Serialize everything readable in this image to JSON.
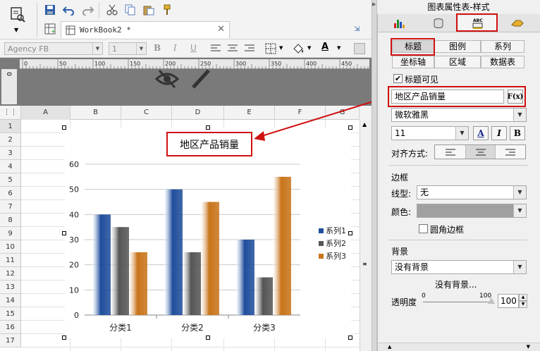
{
  "tab": {
    "label": "WorkBook2 *"
  },
  "format": {
    "font": "Agency FB",
    "size": "1"
  },
  "columns": [
    "A",
    "B",
    "C",
    "D",
    "E",
    "F",
    "G"
  ],
  "rows": [
    "1",
    "2",
    "3",
    "4",
    "5",
    "6",
    "7",
    "8",
    "9",
    "10",
    "11",
    "12",
    "13",
    "14",
    "15",
    "16",
    "17"
  ],
  "chart_data": {
    "type": "bar",
    "title": "地区产品销量",
    "categories": [
      "分类1",
      "分类2",
      "分类3"
    ],
    "series": [
      {
        "name": "系列1",
        "values": [
          40,
          50,
          30
        ],
        "color": "#1f4e9c"
      },
      {
        "name": "系列2",
        "values": [
          35,
          25,
          15
        ],
        "color": "#555555"
      },
      {
        "name": "系列3",
        "values": [
          25,
          45,
          55
        ],
        "color": "#c8741a"
      }
    ],
    "ylim": [
      0,
      60
    ],
    "yticks": [
      "0",
      "10",
      "20",
      "30",
      "40",
      "50",
      "60"
    ],
    "legend": "right",
    "grid": true
  },
  "panel": {
    "title": "图表属性表-样式",
    "subtabs_row1": [
      "标题",
      "图例",
      "系列"
    ],
    "subtabs_row2": [
      "坐标轴",
      "区域",
      "数据表"
    ],
    "title_visible_label": "标题可见",
    "title_input": "地区产品销量",
    "fx_label": "F(x)",
    "font_family": "微软雅黑",
    "font_size": "11",
    "btn_a": "A",
    "btn_i": "I",
    "btn_b": "B",
    "align_label": "对齐方式:",
    "border_header": "边框",
    "line_type_label": "线型:",
    "line_type_value": "无",
    "color_label": "颜色:",
    "rounded_label": "圆角边框",
    "background_header": "背景",
    "background_value": "没有背景",
    "background_preview": "没有背景...",
    "opacity_label": "透明度",
    "opacity_min": "0",
    "opacity_max": "100",
    "opacity_value": "100"
  },
  "colors": {
    "accent_red": "#d01010"
  }
}
